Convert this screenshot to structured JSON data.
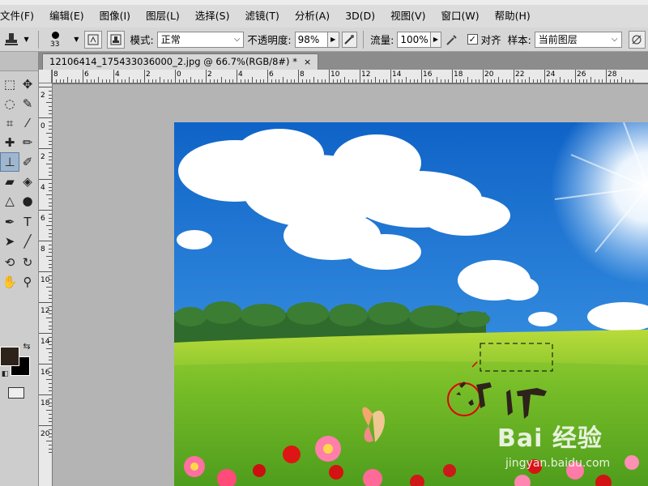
{
  "menubar": {
    "items": [
      "文件(F)",
      "编辑(E)",
      "图像(I)",
      "图层(L)",
      "选择(S)",
      "滤镜(T)",
      "分析(A)",
      "3D(D)",
      "视图(V)",
      "窗口(W)",
      "帮助(H)"
    ]
  },
  "options": {
    "brush_size": "33",
    "mode_label": "模式:",
    "mode_value": "正常",
    "opacity_label": "不透明度:",
    "opacity_value": "98%",
    "flow_label": "流量:",
    "flow_value": "100%",
    "aligned_label": "对齐",
    "aligned_checked": true,
    "sample_label": "样本:",
    "sample_value": "当前图层"
  },
  "document": {
    "tab_title": "12106414_175433036000_2.jpg @ 66.7%(RGB/8#) *",
    "close": "×"
  },
  "rulers": {
    "horizontal": [
      "8",
      "6",
      "4",
      "2",
      "0",
      "2",
      "4",
      "6",
      "8",
      "10",
      "12",
      "14",
      "16",
      "18",
      "20",
      "22",
      "24",
      "26",
      "28"
    ],
    "vertical": [
      "2",
      "0",
      "2",
      "4",
      "6",
      "8",
      "10",
      "12",
      "14",
      "16",
      "18",
      "20"
    ]
  },
  "canvas": {
    "stamp_text": "T 仲"
  },
  "watermark": {
    "brand": "Bai 经验",
    "url": "jingyan.baidu.com"
  },
  "colors": {
    "foreground": "#2d231a",
    "background": "#000000",
    "annotation": "#e00000"
  }
}
